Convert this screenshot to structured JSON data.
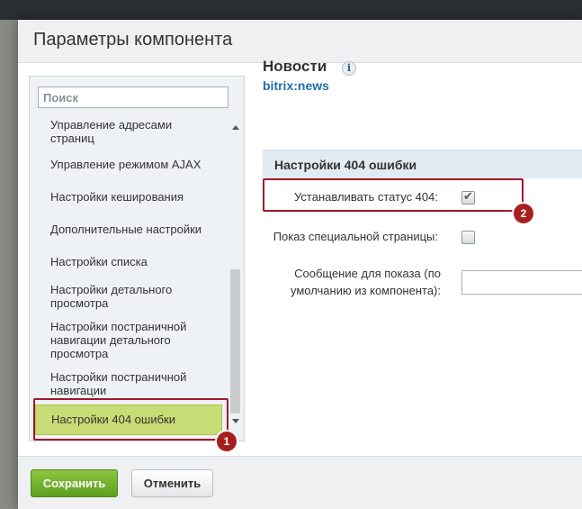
{
  "dialog": {
    "title": "Параметры компонента",
    "component_title": "Новости",
    "component_code": "bitrix:news"
  },
  "sidebar": {
    "search_placeholder": "Поиск",
    "items": [
      {
        "label": "Управление адресами страниц"
      },
      {
        "label": "Управление режимом AJAX"
      },
      {
        "label": "Настройки кеширования"
      },
      {
        "label": "Дополнительные настройки"
      },
      {
        "label": "Настройки списка"
      },
      {
        "label": "Настройки детального просмотра"
      },
      {
        "label": "Настройки постраничной навигации детального просмотра"
      },
      {
        "label": "Настройки постраничной навигации"
      },
      {
        "label": "Настройки 404 ошибки",
        "active": true
      }
    ]
  },
  "section": {
    "title": "Настройки 404 ошибки",
    "fields": [
      {
        "label": "Устанавливать статус 404:",
        "checked": true
      },
      {
        "label": "Показ специальной страницы:",
        "checked": false
      },
      {
        "label": "Сообщение для показа (по умолчанию из компонента):",
        "value": ""
      }
    ]
  },
  "badges": [
    "1",
    "2"
  ],
  "footer": {
    "save_label": "Сохранить",
    "cancel_label": "Отменить"
  },
  "colors": {
    "active_item": "#c7dc74",
    "save_button": "#6aa928",
    "annotation": "#a2182a",
    "link": "#1f6fa8"
  },
  "icons": [
    "info-icon",
    "checkbox-checked-icon",
    "scroll-up-icon",
    "scroll-down-icon"
  ]
}
